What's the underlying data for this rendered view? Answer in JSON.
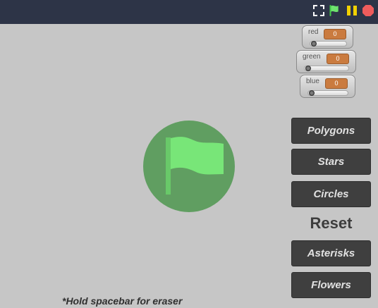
{
  "window": {
    "top_bar": {
      "icons": [
        {
          "name": "fullscreen-icon"
        },
        {
          "name": "green-flag-icon"
        },
        {
          "name": "pause-icon"
        },
        {
          "name": "stop-icon"
        }
      ]
    }
  },
  "stage": {
    "sliders": [
      {
        "label": "red",
        "value": "0"
      },
      {
        "label": "green",
        "value": "0"
      },
      {
        "label": "blue",
        "value": "0"
      }
    ],
    "buttons": {
      "polygons": "Polygons",
      "stars": "Stars",
      "circles": "Circles",
      "asterisks": "Asterisks",
      "flowers": "Flowers"
    },
    "reset_label": "Reset",
    "hint": "*Hold spacebar for eraser"
  },
  "colors": {
    "top_bar": "#2d3447",
    "stage_background": "#c6c6c6",
    "flag_overlay": "#609e61",
    "flag": "#78e678",
    "button": "#3f3f3f",
    "slider_value": "#ca7b3f",
    "stop": "#ef5c5c",
    "pause": "#f2d100"
  }
}
